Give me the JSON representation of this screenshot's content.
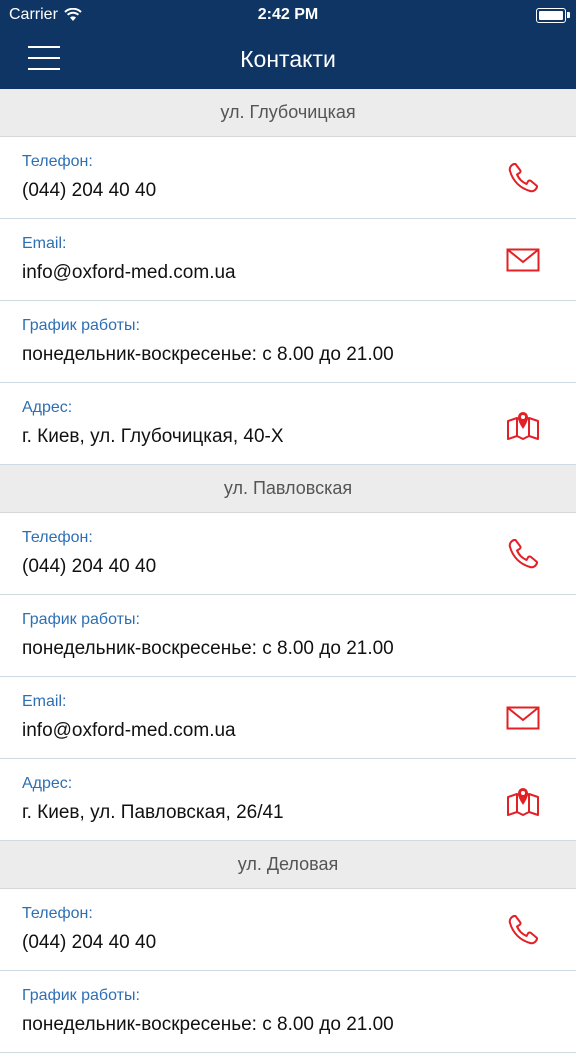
{
  "status_bar": {
    "carrier": "Carrier",
    "time": "2:42 PM"
  },
  "nav": {
    "title": "Контакти"
  },
  "colors": {
    "nav_bg": "#0f3564",
    "label": "#2c6fb5",
    "icon": "#e32026"
  },
  "sections": [
    {
      "title": "ул. Глубочицкая",
      "rows": [
        {
          "label": "Телефон:",
          "value": "(044) 204 40 40",
          "icon": "phone-icon"
        },
        {
          "label": "Email:",
          "value": "info@oxford-med.com.ua",
          "icon": "mail-icon"
        },
        {
          "label": "График работы:",
          "value": "понедельник-воскресенье: с 8.00 до 21.00",
          "icon": ""
        },
        {
          "label": "Адрес:",
          "value": " г. Киев, ул. Глубочицкая, 40-Х",
          "icon": "map-icon"
        }
      ]
    },
    {
      "title": "ул. Павловская",
      "rows": [
        {
          "label": "Телефон:",
          "value": "(044) 204 40 40",
          "icon": "phone-icon"
        },
        {
          "label": "График работы:",
          "value": "понедельник-воскресенье: с 8.00 до 21.00",
          "icon": ""
        },
        {
          "label": "Email:",
          "value": "info@oxford-med.com.ua",
          "icon": "mail-icon"
        },
        {
          "label": "Адрес:",
          "value": "г. Киев, ул. Павловская, 26/41",
          "icon": "map-icon"
        }
      ]
    },
    {
      "title": "ул. Деловая",
      "rows": [
        {
          "label": "Телефон:",
          "value": "(044) 204 40 40",
          "icon": "phone-icon"
        },
        {
          "label": "График работы:",
          "value": "понедельник-воскресенье: с 8.00 до 21.00",
          "icon": ""
        }
      ]
    }
  ]
}
